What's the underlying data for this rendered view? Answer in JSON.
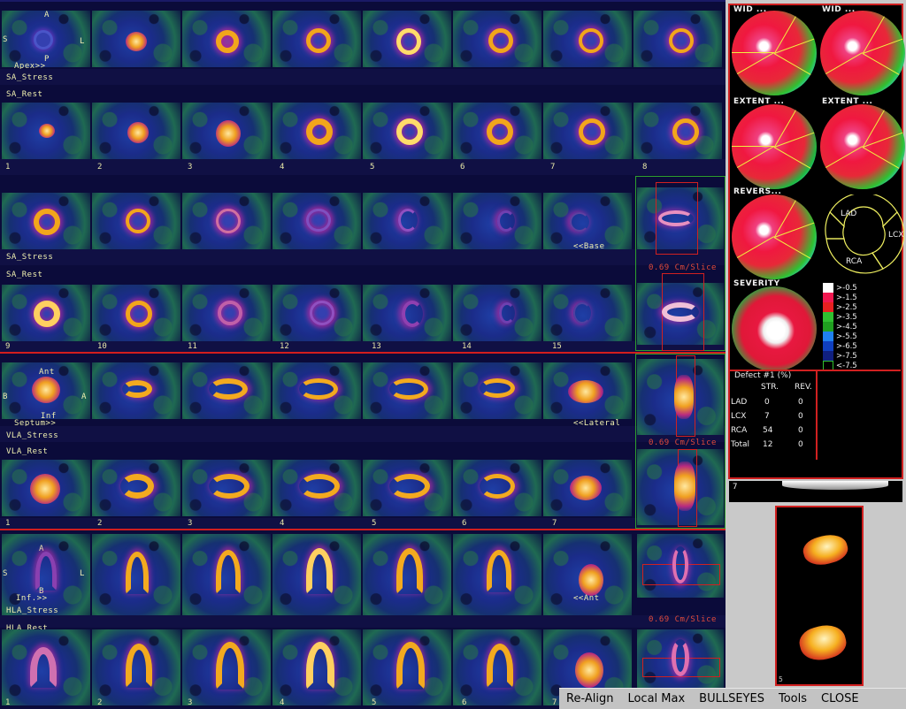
{
  "sa_block_1": {
    "orientation": {
      "top": "A",
      "left": "S",
      "right": "L",
      "bottom": "P"
    },
    "apex_label": "Apex>>",
    "stress_label": "SA_Stress",
    "rest_label": "SA_Rest",
    "slice_numbers": [
      "1",
      "2",
      "3",
      "4",
      "5",
      "6",
      "7",
      "8"
    ]
  },
  "sa_block_2": {
    "base_label": "<<Base",
    "stress_label": "SA_Stress",
    "rest_label": "SA_Rest",
    "slice_numbers": [
      "9",
      "10",
      "11",
      "12",
      "13",
      "14",
      "15"
    ],
    "spacing_label": "0.69 Cm/Slice"
  },
  "vla_block": {
    "orientation": {
      "top": "Ant",
      "left": "B",
      "right": "A",
      "bottom": "Inf"
    },
    "septum_label": "Septum>>",
    "lateral_label": "<<Lateral",
    "stress_label": "VLA_Stress",
    "rest_label": "VLA_Rest",
    "slice_numbers": [
      "1",
      "2",
      "3",
      "4",
      "5",
      "6",
      "7"
    ],
    "spacing_label": "0.69 Cm/Slice"
  },
  "hla_block": {
    "orientation": {
      "top": "A",
      "left": "S",
      "right": "L",
      "bottom": "B"
    },
    "inf_label": "Inf.>>",
    "ant_label": "<<Ant",
    "stress_label": "HLA_Stress",
    "rest_label": "HLA_Rest",
    "slice_numbers": [
      "1",
      "2",
      "3",
      "4",
      "5",
      "6",
      "7"
    ],
    "spacing_label": "0.69 Cm/Slice"
  },
  "bullseyes": {
    "titles": [
      "WID ...",
      "WID ...",
      "EXTENT ...",
      "EXTENT ...",
      "REVERS...",
      "SEVERITY"
    ],
    "polar_labels": {
      "lad": "LAD",
      "lcx": "LCX",
      "rca": "RCA"
    },
    "legend": [
      {
        "label": ">-0.5",
        "color": "#ffffff"
      },
      {
        "label": ">-1.5",
        "color": "#f01850"
      },
      {
        "label": ">-2.5",
        "color": "#e82020"
      },
      {
        "label": ">-3.5",
        "color": "#30c030"
      },
      {
        "label": ">-4.5",
        "color": "#20a020"
      },
      {
        "label": ">-5.5",
        "color": "#2080f0"
      },
      {
        "label": ">-6.5",
        "color": "#1040c0"
      },
      {
        "label": ">-7.5",
        "color": "#102080"
      },
      {
        "label": "<-7.5",
        "color": "#000000"
      }
    ]
  },
  "defect_table": {
    "title": "Defect #1 (%)",
    "col_stress": "STR.",
    "col_rest": "REV.",
    "rows": [
      {
        "name": "LAD",
        "str": "0",
        "rev": "0"
      },
      {
        "name": "LCX",
        "str": "7",
        "rev": "0"
      },
      {
        "name": "RCA",
        "str": "54",
        "rev": "0"
      },
      {
        "name": "Total",
        "str": "12",
        "rev": "0"
      }
    ]
  },
  "gray_strip_number": "7",
  "preview_number": "5",
  "toolbar": {
    "realign": "Re-Align",
    "localmax": "Local Max",
    "bullseyes": "BULLSEYES",
    "tools": "Tools",
    "close": "CLOSE"
  },
  "colors": {
    "accent_red": "#d21e1e",
    "accent_green": "#2ea02e",
    "background": "#0b0b3a"
  }
}
